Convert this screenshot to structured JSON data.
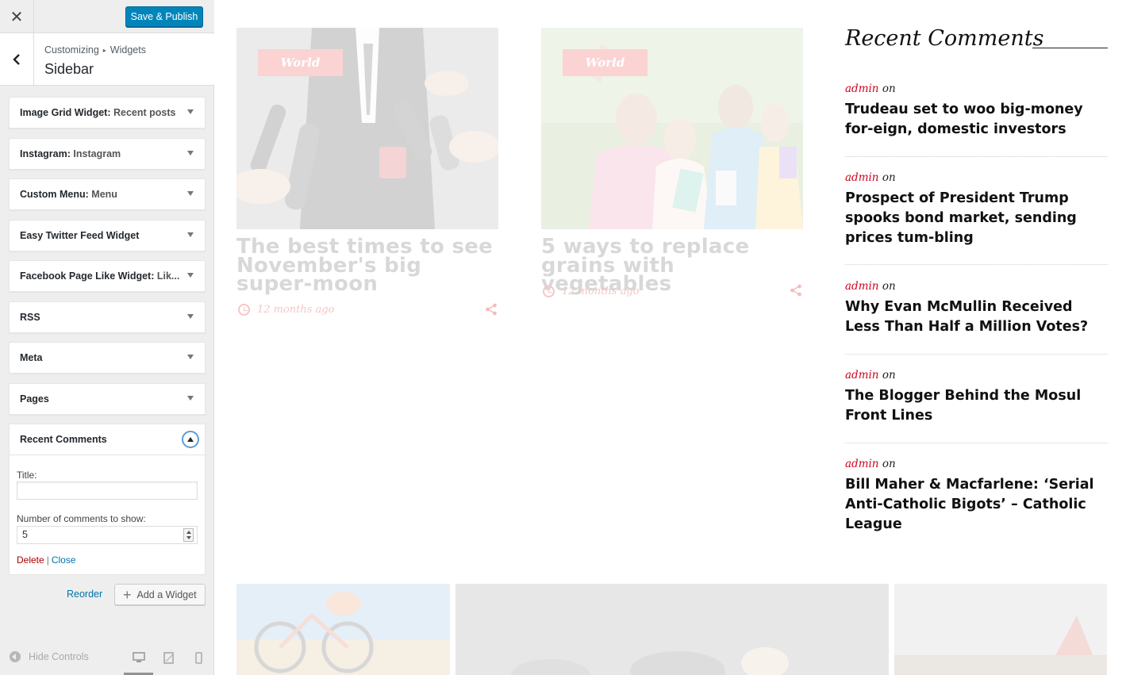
{
  "header": {
    "close_glyph": "✕",
    "save_label": "Save & Publish"
  },
  "section": {
    "crumb_root": "Customizing",
    "crumb_sep": "▸",
    "crumb_leaf": "Widgets",
    "title": "Sidebar"
  },
  "widgets": [
    {
      "name": "Image Grid Widget:",
      "sub": "Recent posts"
    },
    {
      "name": "Instagram:",
      "sub": "Instagram"
    },
    {
      "name": "Custom Menu:",
      "sub": "Menu"
    },
    {
      "name": "Easy Twitter Feed Widget",
      "sub": ""
    },
    {
      "name": "Facebook Page Like Widget:",
      "sub": "Lik..."
    },
    {
      "name": "RSS",
      "sub": ""
    },
    {
      "name": "Meta",
      "sub": ""
    },
    {
      "name": "Pages",
      "sub": ""
    }
  ],
  "recent_comments_widget": {
    "name": "Recent Comments",
    "title_label": "Title:",
    "title_value": "",
    "count_label": "Number of comments to show:",
    "count_value": "5",
    "delete_label": "Delete",
    "pipe": "|",
    "close_label": "Close"
  },
  "footer": {
    "reorder_label": "Reorder",
    "add_widget_plus": "+",
    "add_widget_label": "Add a Widget",
    "hide_controls_label": "Hide Controls"
  },
  "preview": {
    "cards": [
      {
        "category": "World",
        "title": "The best times to see November's big super-moon",
        "meta": "12 months ago"
      },
      {
        "category": "World",
        "title": "5 ways to replace grains with vegetables",
        "meta": "12 months ago"
      }
    ],
    "recent_comments": {
      "title": "Recent Comments",
      "on_word": "on",
      "items": [
        {
          "author": "admin",
          "post": "Trudeau set to woo big-money for-eign, domestic investors"
        },
        {
          "author": "admin",
          "post": "Prospect of President Trump spooks bond market, sending prices tum-bling"
        },
        {
          "author": "admin",
          "post": "Why Evan McMullin Received Less Than Half a Million Votes?"
        },
        {
          "author": "admin",
          "post": "The Blogger Behind the Mosul Front Lines"
        },
        {
          "author": "admin",
          "post": "Bill Maher & Macfarlene: ‘Serial Anti-Catholic Bigots’ – Catholic League"
        }
      ]
    }
  },
  "colors": {
    "accent": "#0085ba",
    "link": "#0073aa",
    "delete": "#aa0000",
    "author_red": "#d0021b",
    "badge_pink": "#fbd3d3"
  }
}
